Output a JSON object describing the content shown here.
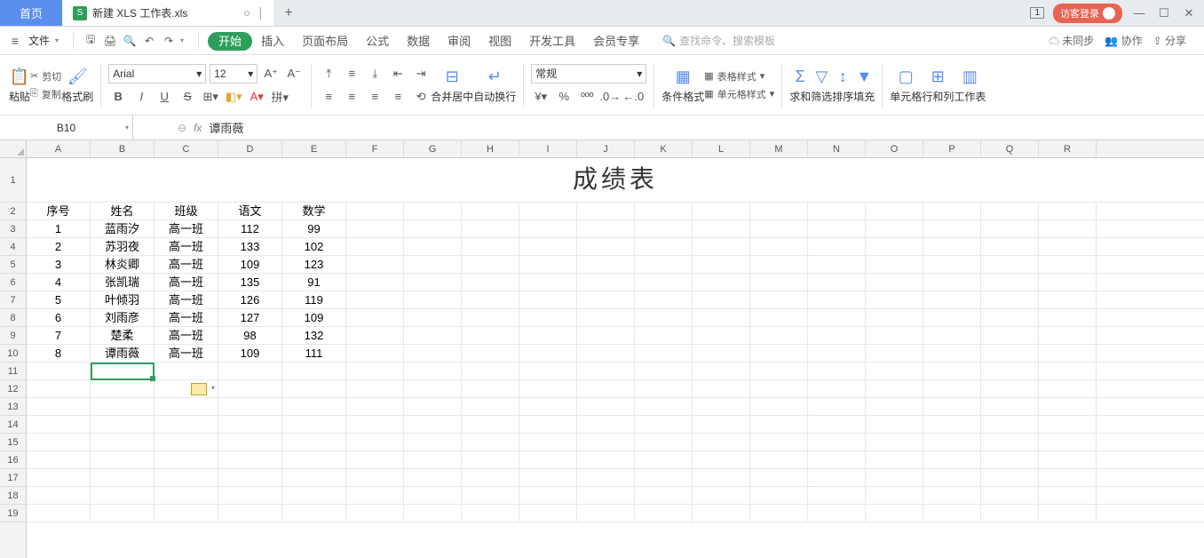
{
  "titlebar": {
    "home": "首页",
    "filename": "新建 XLS 工作表.xls",
    "badge": "1",
    "login": "访客登录"
  },
  "menubar": {
    "file": "文件",
    "tabs": [
      "开始",
      "插入",
      "页面布局",
      "公式",
      "数据",
      "审阅",
      "视图",
      "开发工具",
      "会员专享"
    ],
    "search_placeholder": "查找命令、搜索模板",
    "unsync": "未同步",
    "cooperate": "协作",
    "share": "分享"
  },
  "ribbon": {
    "paste": "粘贴",
    "cut": "剪切",
    "copy": "复制",
    "painter": "格式刷",
    "font": "Arial",
    "fontsize": "12",
    "merge": "合并居中",
    "wrap": "自动换行",
    "numfmt": "常规",
    "condfmt": "条件格式",
    "tablefmt": "表格样式",
    "cellfmt": "单元格样式",
    "sum": "求和",
    "filter": "筛选",
    "sort": "排序",
    "fill": "填充",
    "cell": "单元格",
    "rowcol": "行和列",
    "worksheet": "工作表"
  },
  "namebox": "B10",
  "formula": "谭雨薇",
  "columns": [
    "A",
    "B",
    "C",
    "D",
    "E",
    "F",
    "G",
    "H",
    "I",
    "J",
    "K",
    "L",
    "M",
    "N",
    "O",
    "P",
    "Q",
    "R"
  ],
  "title_text": "成绩表",
  "headers": [
    "序号",
    "姓名",
    "班级",
    "语文",
    "数学"
  ],
  "data": [
    [
      "1",
      "蓝雨汐",
      "高一班",
      "112",
      "99"
    ],
    [
      "2",
      "苏羽夜",
      "高一班",
      "133",
      "102"
    ],
    [
      "3",
      "林炎卿",
      "高一班",
      "109",
      "123"
    ],
    [
      "4",
      "张凯瑞",
      "高一班",
      "135",
      "91"
    ],
    [
      "5",
      "叶倾羽",
      "高一班",
      "126",
      "119"
    ],
    [
      "6",
      "刘雨彦",
      "高一班",
      "127",
      "109"
    ],
    [
      "7",
      "楚柔",
      "高一班",
      "98",
      "132"
    ],
    [
      "8",
      "谭雨薇",
      "高一班",
      "109",
      "111"
    ]
  ],
  "row_nums": [
    1,
    2,
    3,
    4,
    5,
    6,
    7,
    8,
    9,
    10,
    11,
    12,
    13,
    14,
    15,
    16,
    17,
    18,
    19
  ]
}
